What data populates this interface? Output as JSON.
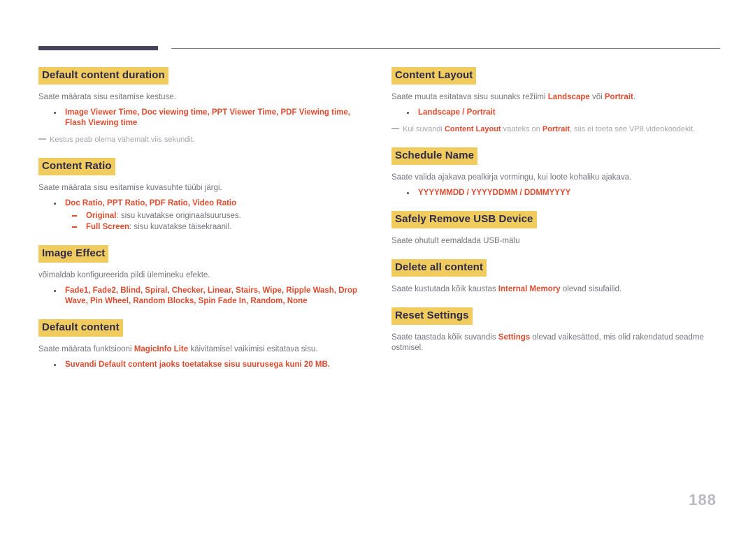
{
  "page": {
    "number": "188",
    "accent_color": "#dd4b2f",
    "highlight_color": "#f0cb5e",
    "heading_text_color": "#2f2a4a",
    "body_text_color": "#76747a",
    "rule_color": "#474159"
  },
  "left_column": {
    "sections": [
      {
        "heading": "Default content duration",
        "body_prefix": "Saate määrata sisu esitamise kestuse.",
        "bullet": "Image Viewer Time, Doc viewing time, PPT Viewer Time, PDF Viewing time, Flash Viewing time",
        "note": "Kestus peab olema vähemalt viis sekundit."
      },
      {
        "heading": "Content Ratio",
        "body_prefix": "Saate määrata sisu esitamise kuvasuhte tüübi järgi.",
        "bullet": "Doc Ratio, PPT Ratio, PDF Ratio, Video Ratio",
        "sub_items": [
          {
            "term": "Original",
            "text": ": sisu kuvatakse originaalsuuruses."
          },
          {
            "term": "Full Screen",
            "text": ": sisu kuvatakse täisekraanil."
          }
        ]
      },
      {
        "heading": "Image Effect",
        "body_prefix": "võimaldab konfigureerida pildi ülemineku efekte.",
        "bullet": "Fade1, Fade2, Blind, Spiral, Checker, Linear, Stairs, Wipe, Ripple Wash, Drop Wave, Pin Wheel, Random Blocks, Spin Fade In, Random, None"
      },
      {
        "heading": "Default content",
        "body_parts": [
          {
            "text": "Saate määrata funktsiooni ",
            "accent": false
          },
          {
            "text": "MagicInfo Lite",
            "accent": true
          },
          {
            "text": " käivitamisel vaikimisi esitatava sisu.",
            "accent": false
          }
        ],
        "bullet_parts": [
          {
            "text": "Suvandi ",
            "accent": false
          },
          {
            "text": "Default content",
            "accent": true
          },
          {
            "text": " jaoks toetatakse sisu suurusega kuni 20 MB.",
            "accent": false
          }
        ]
      }
    ]
  },
  "right_column": {
    "sections": [
      {
        "heading": "Content Layout",
        "body_parts": [
          {
            "text": "Saate muuta esitatava sisu suunaks režiimi ",
            "accent": false
          },
          {
            "text": "Landscape",
            "accent": true
          },
          {
            "text": " või ",
            "accent": false
          },
          {
            "text": "Portrait",
            "accent": true
          },
          {
            "text": ".",
            "accent": false
          }
        ],
        "bullet": "Landscape / Portrait",
        "note_parts": [
          {
            "text": "Kui suvandi ",
            "accent": false
          },
          {
            "text": "Content Layout",
            "accent": true
          },
          {
            "text": " vaateks on ",
            "accent": false
          },
          {
            "text": "Portrait",
            "accent": true
          },
          {
            "text": ", siis ei toeta see VP8 videokoodekit.",
            "accent": false
          }
        ]
      },
      {
        "heading": "Schedule Name",
        "body_prefix": "Saate valida ajakava pealkirja vormingu, kui loote kohaliku ajakava.",
        "bullet": "YYYYMMDD / YYYYDDMM / DDMMYYYY"
      },
      {
        "heading": "Safely Remove USB Device",
        "body_prefix": "Saate ohutult eemaldada USB-mälu"
      },
      {
        "heading": "Delete all content",
        "body_parts": [
          {
            "text": "Saate kustutada kõik kaustas ",
            "accent": false
          },
          {
            "text": "Internal Memory",
            "accent": true
          },
          {
            "text": " olevad sisufailid.",
            "accent": false
          }
        ]
      },
      {
        "heading": "Reset Settings",
        "body_parts": [
          {
            "text": "Saate taastada kõik suvandis ",
            "accent": false
          },
          {
            "text": "Settings",
            "accent": true
          },
          {
            "text": " olevad vaikesätted, mis olid rakendatud seadme ostmisel.",
            "accent": false
          }
        ]
      }
    ]
  }
}
